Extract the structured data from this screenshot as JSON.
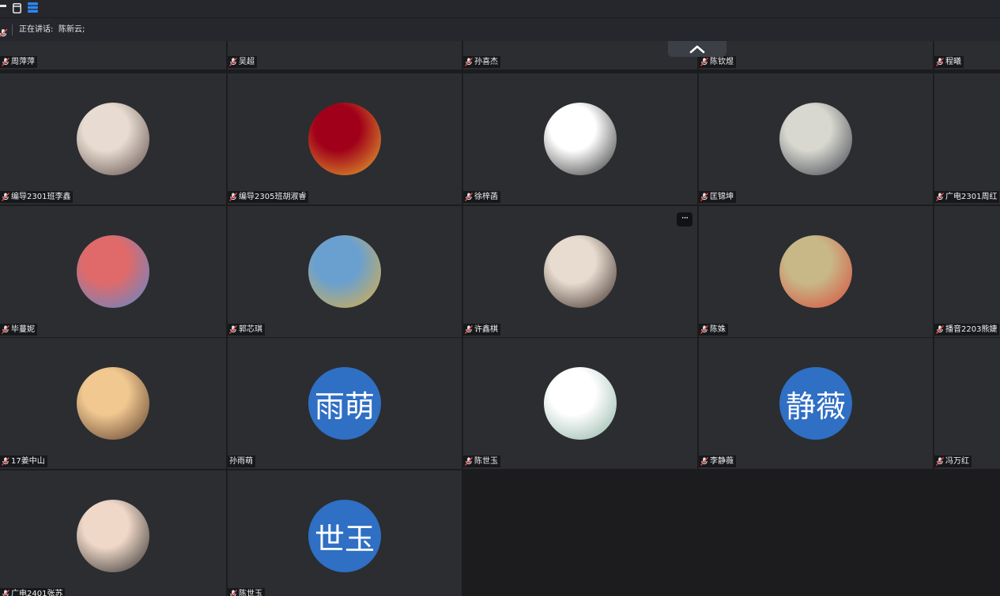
{
  "speaking": {
    "label": "正在讲话:",
    "name": "陈新云;"
  },
  "colors": {
    "tile_bg": "#2b2d31",
    "empty_bg": "#1c1c1e",
    "text_avatar": "#2f6fc4",
    "nametag_bg": "#17181b"
  },
  "participants": [
    {
      "name": "周萍萍",
      "muted": true,
      "avatar": "photo",
      "colors": [
        "#d9d9d9",
        "#8a8a8a"
      ]
    },
    {
      "name": "吴超",
      "muted": true,
      "avatar": "photo",
      "colors": [
        "#d9d9d9",
        "#8a8a8a"
      ]
    },
    {
      "name": "孙喜杰",
      "muted": true,
      "avatar": "photo",
      "colors": [
        "#c9a36a",
        "#6b4a2a"
      ]
    },
    {
      "name": "陈钦煜",
      "muted": true,
      "avatar": "photo",
      "colors": [
        "#3a3a3a",
        "#1a1a1a"
      ]
    },
    {
      "name": "程曦",
      "muted": true,
      "avatar": "none"
    },
    {
      "name": "编导2301班李鑫",
      "muted": true,
      "avatar": "photo",
      "colors": [
        "#e8dcd2",
        "#5a4a44"
      ]
    },
    {
      "name": "编导2305班胡淑睿",
      "muted": true,
      "avatar": "photo",
      "colors": [
        "#a0001a",
        "#e8b030"
      ]
    },
    {
      "name": "徐梓菡",
      "muted": true,
      "avatar": "photo",
      "colors": [
        "#ffffff",
        "#2a2a2a"
      ]
    },
    {
      "name": "匡锦坤",
      "muted": true,
      "avatar": "photo",
      "colors": [
        "#d8d8d0",
        "#3a3f48"
      ]
    },
    {
      "name": "广电2301周红",
      "muted": true,
      "avatar": "none"
    },
    {
      "name": "毕蔓妮",
      "muted": true,
      "avatar": "photo",
      "colors": [
        "#e06a6a",
        "#5a8ad0"
      ]
    },
    {
      "name": "郭芯琪",
      "muted": true,
      "avatar": "photo",
      "colors": [
        "#6aa0d0",
        "#e0b040"
      ]
    },
    {
      "name": "许鑫棋",
      "muted": true,
      "avatar": "photo",
      "colors": [
        "#e8dcd0",
        "#3a2a24"
      ]
    },
    {
      "name": "陈姝",
      "muted": true,
      "avatar": "photo",
      "colors": [
        "#c8b888",
        "#d84a3a"
      ]
    },
    {
      "name": "播音2203熊婕",
      "muted": true,
      "avatar": "none"
    },
    {
      "name": "17姜中山",
      "muted": true,
      "avatar": "photo",
      "colors": [
        "#f0c890",
        "#5a3a2a"
      ]
    },
    {
      "name": "孙雨萌",
      "muted": false,
      "avatar": "text",
      "initials": "雨萌"
    },
    {
      "name": "陈世玉",
      "muted": true,
      "avatar": "photo",
      "colors": [
        "#ffffff",
        "#8ab0a0"
      ]
    },
    {
      "name": "李静薇",
      "muted": true,
      "avatar": "text",
      "initials": "静薇"
    },
    {
      "name": "冯万红",
      "muted": true,
      "avatar": "none"
    },
    {
      "name": "广电2401张苏",
      "muted": true,
      "avatar": "photo",
      "colors": [
        "#f0d8c8",
        "#2a2a2a"
      ]
    },
    {
      "name": "陈世玉",
      "muted": true,
      "avatar": "text",
      "initials": "世玉"
    }
  ]
}
